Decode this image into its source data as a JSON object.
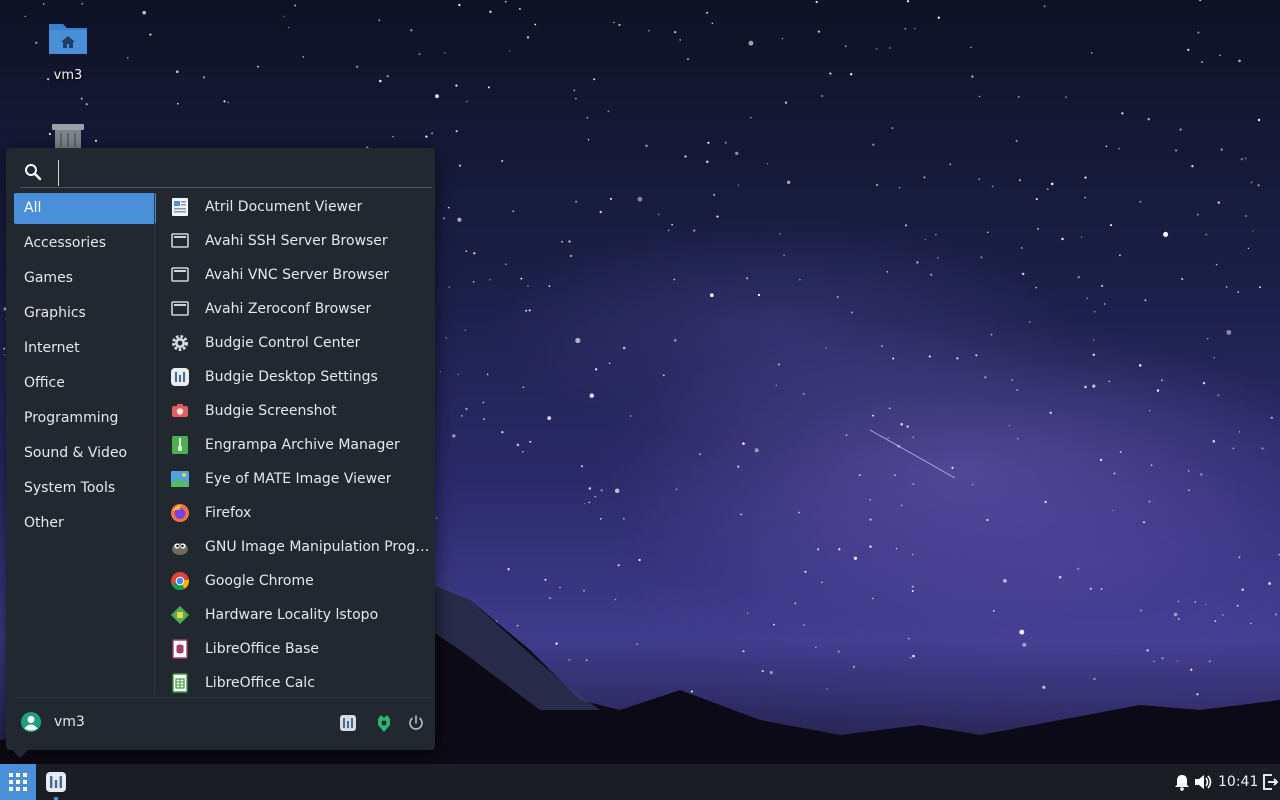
{
  "desktop": {
    "icons": [
      {
        "label": "vm3",
        "icon": "home-folder-icon"
      },
      {
        "label": "",
        "icon": "trash-icon"
      }
    ]
  },
  "menu": {
    "search": {
      "value": "",
      "placeholder": ""
    },
    "categories": [
      {
        "label": "All",
        "active": true
      },
      {
        "label": "Accessories"
      },
      {
        "label": "Games"
      },
      {
        "label": "Graphics"
      },
      {
        "label": "Internet"
      },
      {
        "label": "Office"
      },
      {
        "label": "Programming"
      },
      {
        "label": "Sound & Video"
      },
      {
        "label": "System Tools"
      },
      {
        "label": "Other"
      }
    ],
    "apps": [
      {
        "label": "Atril Document Viewer",
        "icon": "document-viewer-icon"
      },
      {
        "label": "Avahi SSH Server Browser",
        "icon": "network-browser-icon"
      },
      {
        "label": "Avahi VNC Server Browser",
        "icon": "network-browser-icon"
      },
      {
        "label": "Avahi Zeroconf Browser",
        "icon": "network-browser-icon"
      },
      {
        "label": "Budgie Control Center",
        "icon": "gear-icon"
      },
      {
        "label": "Budgie Desktop Settings",
        "icon": "budgie-settings-icon"
      },
      {
        "label": "Budgie Screenshot",
        "icon": "camera-icon"
      },
      {
        "label": "Engrampa Archive Manager",
        "icon": "archive-icon"
      },
      {
        "label": "Eye of MATE Image Viewer",
        "icon": "image-viewer-icon"
      },
      {
        "label": "Firefox",
        "icon": "firefox-icon"
      },
      {
        "label": "GNU Image Manipulation Progr…",
        "icon": "gimp-icon"
      },
      {
        "label": "Google Chrome",
        "icon": "chrome-icon"
      },
      {
        "label": "Hardware Locality lstopo",
        "icon": "lstopo-icon"
      },
      {
        "label": "LibreOffice Base",
        "icon": "libreoffice-base-icon"
      },
      {
        "label": "LibreOffice Calc",
        "icon": "libreoffice-calc-icon"
      }
    ],
    "footer": {
      "user_name": "vm3",
      "buttons": [
        "settings-icon",
        "lock-icon",
        "power-icon"
      ]
    }
  },
  "panel": {
    "clock": "10:41",
    "tray": [
      "bell-icon",
      "volume-icon",
      "logout-icon"
    ]
  },
  "colors": {
    "accent": "#4a90d9",
    "menu_bg": "#222830",
    "panel_bg": "#1a1e24"
  }
}
